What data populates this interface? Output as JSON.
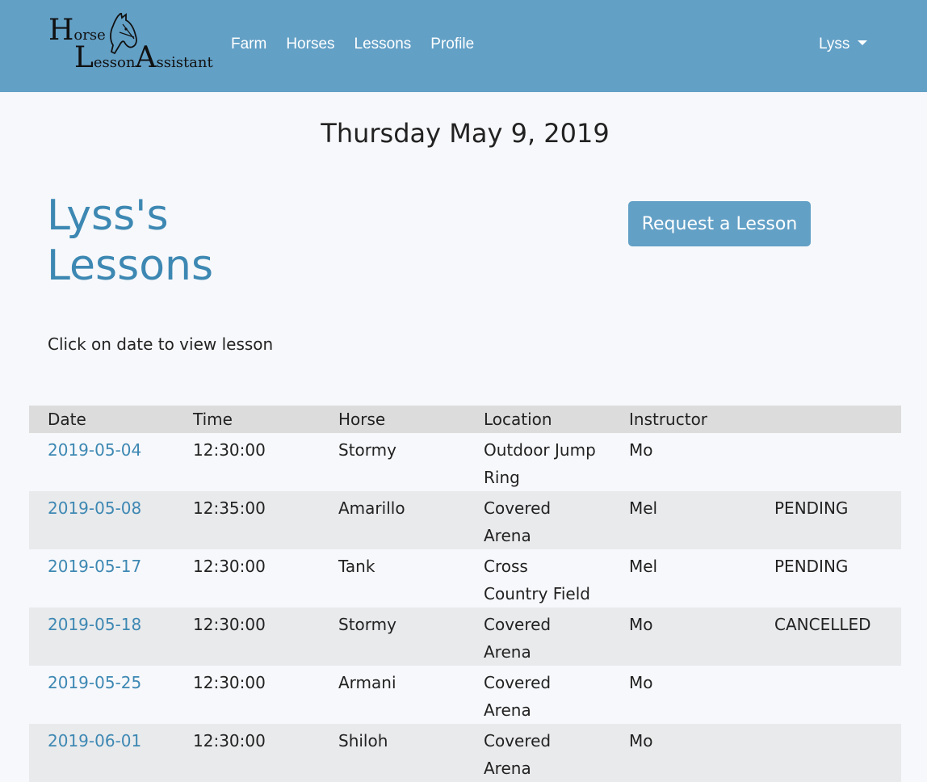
{
  "logo": {
    "line1_big": "H",
    "line1_small": "orse",
    "line2a_big": "L",
    "line2a_small": "esson",
    "line2b_big": "A",
    "line2b_small": "ssistant"
  },
  "nav": {
    "links": [
      "Farm",
      "Horses",
      "Lessons",
      "Profile"
    ],
    "user": "Lyss"
  },
  "date_heading": "Thursday May 9, 2019",
  "page_title": "Lyss's Lessons",
  "request_button": "Request a Lesson",
  "hint": "Click on date to view lesson",
  "table": {
    "headers": [
      "Date",
      "Time",
      "Horse",
      "Location",
      "Instructor",
      ""
    ],
    "rows": [
      {
        "date": "2019-05-04",
        "time": "12:30:00",
        "horse": "Stormy",
        "location": "Outdoor Jump Ring",
        "instructor": "Mo",
        "status": ""
      },
      {
        "date": "2019-05-08",
        "time": "12:35:00",
        "horse": "Amarillo",
        "location": "Covered Arena",
        "instructor": "Mel",
        "status": "PENDING"
      },
      {
        "date": "2019-05-17",
        "time": "12:30:00",
        "horse": "Tank",
        "location": "Cross Country Field",
        "instructor": "Mel",
        "status": "PENDING"
      },
      {
        "date": "2019-05-18",
        "time": "12:30:00",
        "horse": "Stormy",
        "location": "Covered Arena",
        "instructor": "Mo",
        "status": "CANCELLED"
      },
      {
        "date": "2019-05-25",
        "time": "12:30:00",
        "horse": "Armani",
        "location": "Covered Arena",
        "instructor": "Mo",
        "status": ""
      },
      {
        "date": "2019-06-01",
        "time": "12:30:00",
        "horse": "Shiloh",
        "location": "Covered Arena",
        "instructor": "Mo",
        "status": ""
      }
    ]
  },
  "colors": {
    "navbar": "#63a0c6",
    "accent": "#3d88b3",
    "header_row": "#dcdcdc",
    "alt_row": "#e9eaec",
    "background": "#f7f8fb"
  }
}
